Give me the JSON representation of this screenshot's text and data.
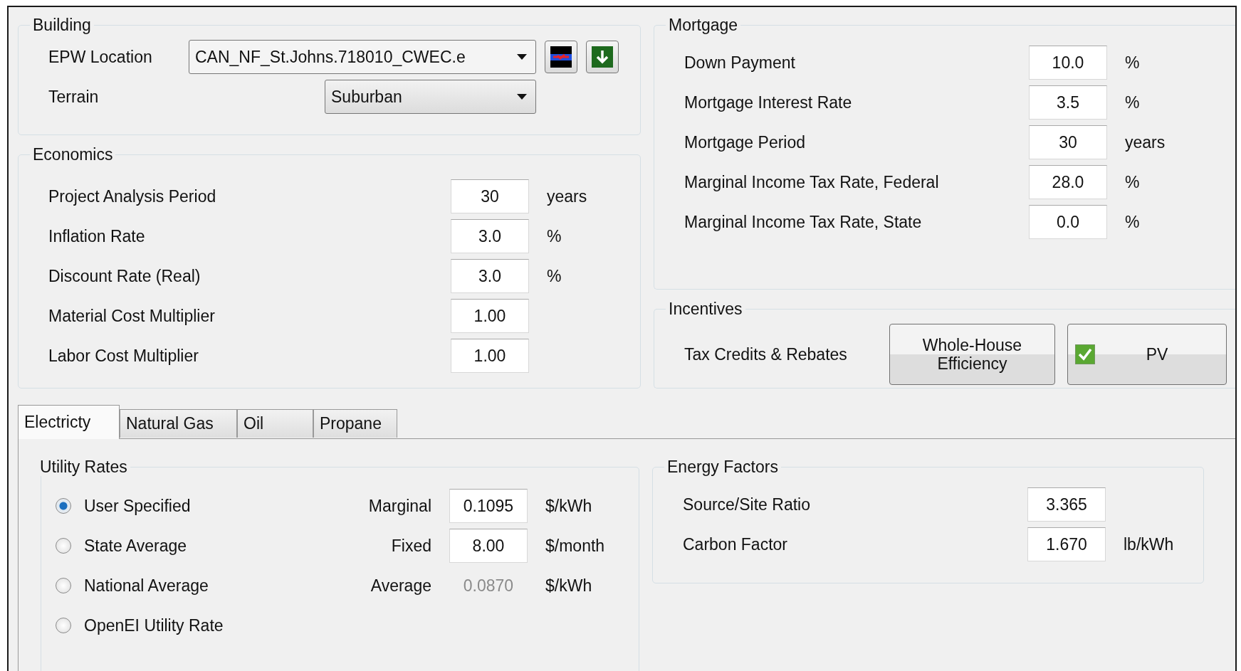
{
  "building": {
    "title": "Building",
    "epw_location": {
      "label": "EPW Location",
      "value": "CAN_NF_St.Johns.718010_CWEC.e"
    },
    "terrain": {
      "label": "Terrain",
      "value": "Suburban"
    }
  },
  "economics": {
    "title": "Economics",
    "rows": [
      {
        "label": "Project Analysis Period",
        "value": "30",
        "unit": "years"
      },
      {
        "label": "Inflation Rate",
        "value": "3.0",
        "unit": "%"
      },
      {
        "label": "Discount Rate (Real)",
        "value": "3.0",
        "unit": "%"
      },
      {
        "label": "Material Cost Multiplier",
        "value": "1.00"
      },
      {
        "label": "Labor Cost Multiplier",
        "value": "1.00"
      }
    ]
  },
  "mortgage": {
    "title": "Mortgage",
    "rows": [
      {
        "label": "Down Payment",
        "value": "10.0",
        "unit": "%"
      },
      {
        "label": "Mortgage Interest Rate",
        "value": "3.5",
        "unit": "%"
      },
      {
        "label": "Mortgage Period",
        "value": "30",
        "unit": "years"
      },
      {
        "label": "Marginal Income Tax Rate, Federal",
        "value": "28.0",
        "unit": "%"
      },
      {
        "label": "Marginal Income Tax Rate, State",
        "value": "0.0",
        "unit": "%"
      }
    ]
  },
  "incentives": {
    "title": "Incentives",
    "label": "Tax Credits & Rebates",
    "buttons": [
      {
        "kind": "plain",
        "label": "Whole-House Efficiency"
      },
      {
        "kind": "check",
        "label": "PV",
        "checked": true
      }
    ]
  },
  "tabs": [
    {
      "label": "Electricty",
      "selected": true
    },
    {
      "label": "Natural Gas",
      "selected": false
    },
    {
      "label": "Oil",
      "selected": false
    },
    {
      "label": "Propane",
      "selected": false
    }
  ],
  "utility_rates": {
    "title": "Utility Rates",
    "options": [
      {
        "label": "User Specified",
        "selected": true
      },
      {
        "label": "State Average",
        "selected": false
      },
      {
        "label": "National Average",
        "selected": false
      },
      {
        "label": "OpenEI Utility Rate",
        "selected": false
      }
    ],
    "rates": [
      {
        "label": "Marginal",
        "value": "0.1095",
        "unit": "$/kWh",
        "disabled": false
      },
      {
        "label": "Fixed",
        "value": "8.00",
        "unit": "$/month",
        "disabled": false
      },
      {
        "label": "Average",
        "value": "0.0870",
        "unit": "$/kWh",
        "disabled": true
      }
    ]
  },
  "energy_factors": {
    "title": "Energy Factors",
    "rows": [
      {
        "label": "Source/Site Ratio",
        "value": "3.365"
      },
      {
        "label": "Carbon Factor",
        "value": "1.670",
        "unit": "lb/kWh"
      }
    ]
  }
}
